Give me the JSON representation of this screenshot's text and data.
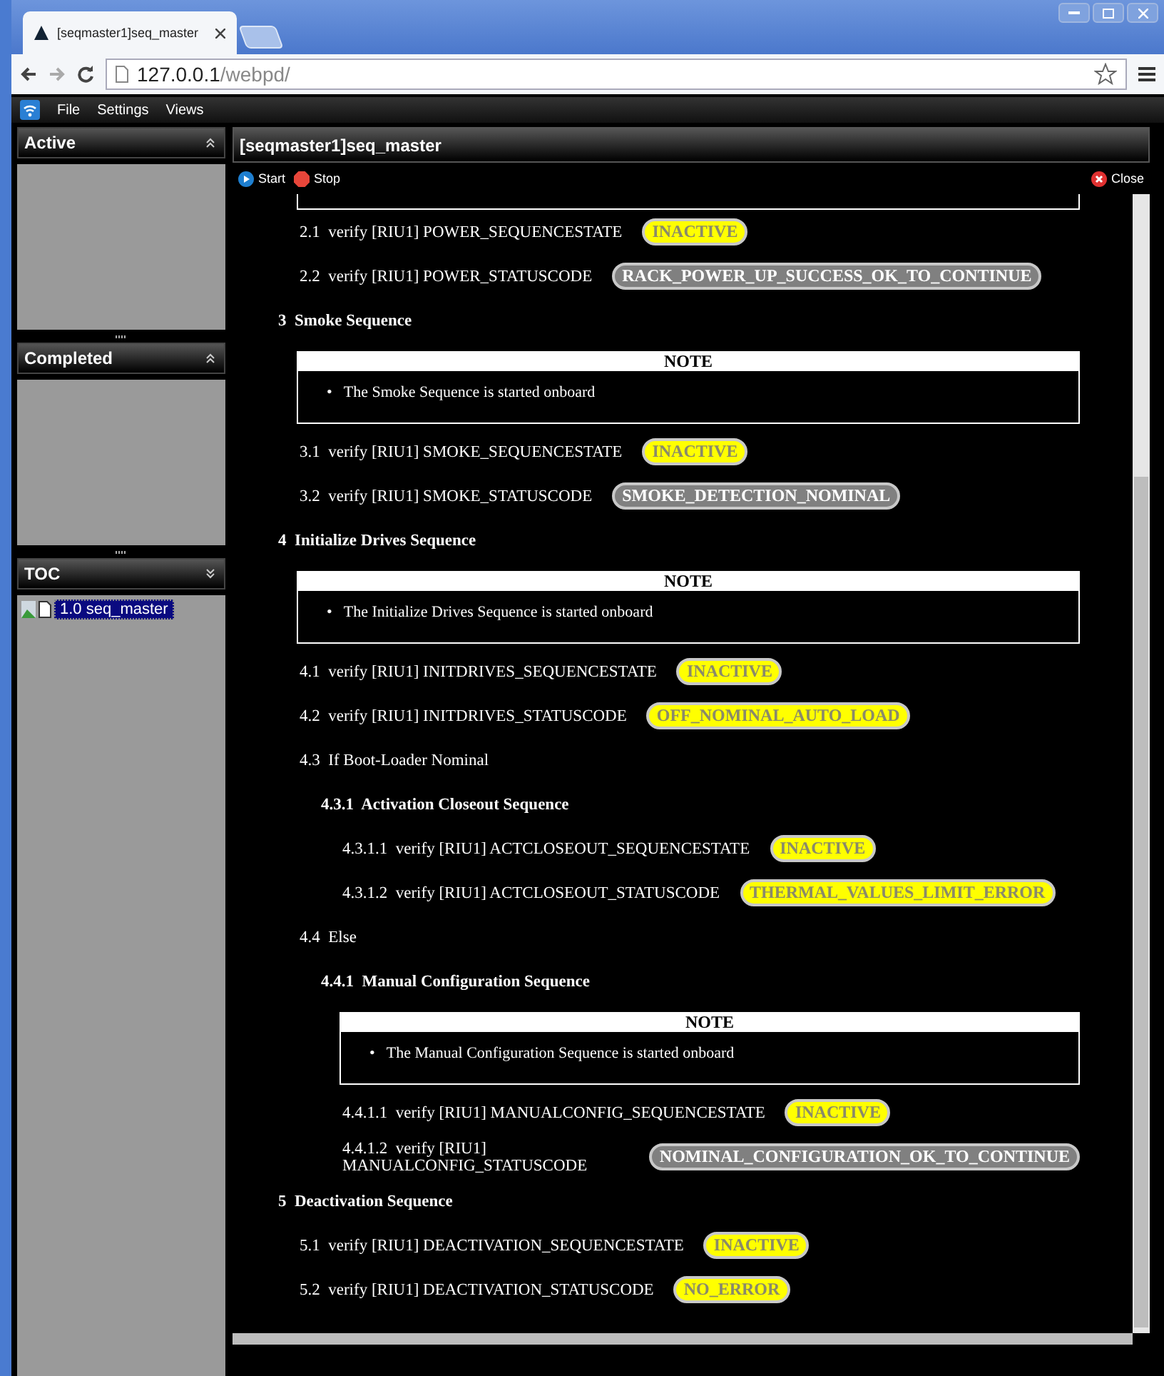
{
  "browser": {
    "tab_title": "[seqmaster1]seq_master",
    "url": {
      "host": "127.0.0.1",
      "path": "/webpd/"
    }
  },
  "menu": [
    "File",
    "Settings",
    "Views"
  ],
  "side_panels": [
    {
      "title": "Active",
      "expanded": true
    },
    {
      "title": "Completed",
      "expanded": true
    },
    {
      "title": "TOC",
      "expanded": false,
      "items": [
        {
          "label": "1.0 seq_master",
          "selected": true
        }
      ]
    }
  ],
  "procedure": {
    "title": "[seqmaster1]seq_master",
    "toolbar": [
      {
        "kind": "start",
        "label": "Start"
      },
      {
        "kind": "stop",
        "label": "Stop"
      }
    ],
    "close": "Close",
    "items": [
      {
        "kind": "group",
        "children": [
          {
            "kind": "step",
            "number": "2.1",
            "text": "verify [RIU1] POWER_SEQUENCESTATE",
            "badge": {
              "value": "INACTIVE",
              "color": "#ffff00"
            }
          },
          {
            "kind": "step",
            "number": "2.2",
            "text": "verify [RIU1] POWER_STATUSCODE",
            "badge": {
              "value": "RACK_POWER_UP_SUCCESS_OK_TO_CONTINUE",
              "color": "#808080"
            }
          }
        ]
      },
      {
        "kind": "section",
        "number": "3",
        "title": "Smoke Sequence",
        "children": [
          {
            "kind": "note",
            "heading": "NOTE",
            "marker": "•",
            "bullets": [
              "The Smoke Sequence is started onboard"
            ]
          },
          {
            "kind": "step",
            "number": "3.1",
            "text": "verify [RIU1] SMOKE_SEQUENCESTATE",
            "badge": {
              "value": "INACTIVE",
              "color": "#ffff00"
            }
          },
          {
            "kind": "step",
            "number": "3.2",
            "text": "verify [RIU1] SMOKE_STATUSCODE",
            "badge": {
              "value": "SMOKE_DETECTION_NOMINAL",
              "color": "#808080"
            }
          }
        ]
      },
      {
        "kind": "section",
        "number": "4",
        "title": "Initialize Drives Sequence",
        "children": [
          {
            "kind": "note",
            "heading": "NOTE",
            "marker": "•",
            "bullets": [
              "The Initialize Drives Sequence is started onboard"
            ]
          },
          {
            "kind": "step",
            "number": "4.1",
            "text": "verify [RIU1] INITDRIVES_SEQUENCESTATE",
            "badge": {
              "value": "INACTIVE",
              "color": "#ffff00"
            }
          },
          {
            "kind": "step",
            "number": "4.2",
            "text": "verify [RIU1] INITDRIVES_STATUSCODE",
            "badge": {
              "value": "OFF_NOMINAL_AUTO_LOAD",
              "color": "#ffff00"
            }
          },
          {
            "kind": "step",
            "number": "4.3",
            "text": "If Boot-Loader Nominal",
            "children": [
              {
                "kind": "section",
                "number": "4.3.1",
                "title": "Activation Closeout Sequence",
                "children": [
                  {
                    "kind": "step",
                    "number": "4.3.1.1",
                    "text": "verify [RIU1] ACTCLOSEOUT_SEQUENCESTATE",
                    "badge": {
                      "value": "INACTIVE",
                      "color": "#ffff00"
                    }
                  },
                  {
                    "kind": "step",
                    "number": "4.3.1.2",
                    "text": "verify [RIU1] ACTCLOSEOUT_STATUSCODE",
                    "badge": {
                      "value": "THERMAL_VALUES_LIMIT_ERROR",
                      "color": "#ffff00"
                    }
                  }
                ]
              }
            ]
          },
          {
            "kind": "step",
            "number": "4.4",
            "text": "Else",
            "children": [
              {
                "kind": "section",
                "number": "4.4.1",
                "title": "Manual Configuration Sequence",
                "children": [
                  {
                    "kind": "note",
                    "heading": "NOTE",
                    "marker": "•",
                    "bullets": [
                      "The Manual Configuration Sequence is started onboard"
                    ]
                  },
                  {
                    "kind": "step",
                    "number": "4.4.1.1",
                    "text": "verify [RIU1] MANUALCONFIG_SEQUENCESTATE",
                    "badge": {
                      "value": "INACTIVE",
                      "color": "#ffff00"
                    }
                  },
                  {
                    "kind": "step",
                    "number": "4.4.1.2",
                    "text": "verify [RIU1] MANUALCONFIG_STATUSCODE",
                    "badge": {
                      "value": "NOMINAL_CONFIGURATION_OK_TO_CONTINUE",
                      "color": "#808080"
                    }
                  }
                ]
              }
            ]
          }
        ]
      },
      {
        "kind": "section",
        "number": "5",
        "title": "Deactivation Sequence",
        "children": [
          {
            "kind": "step",
            "number": "5.1",
            "text": "verify [RIU1] DEACTIVATION_SEQUENCESTATE",
            "badge": {
              "value": "INACTIVE",
              "color": "#ffff00"
            }
          },
          {
            "kind": "step",
            "number": "5.2",
            "text": "verify [RIU1] DEACTIVATION_STATUSCODE",
            "badge": {
              "value": "NO_ERROR",
              "color": "#ffff00"
            }
          }
        ]
      }
    ]
  }
}
